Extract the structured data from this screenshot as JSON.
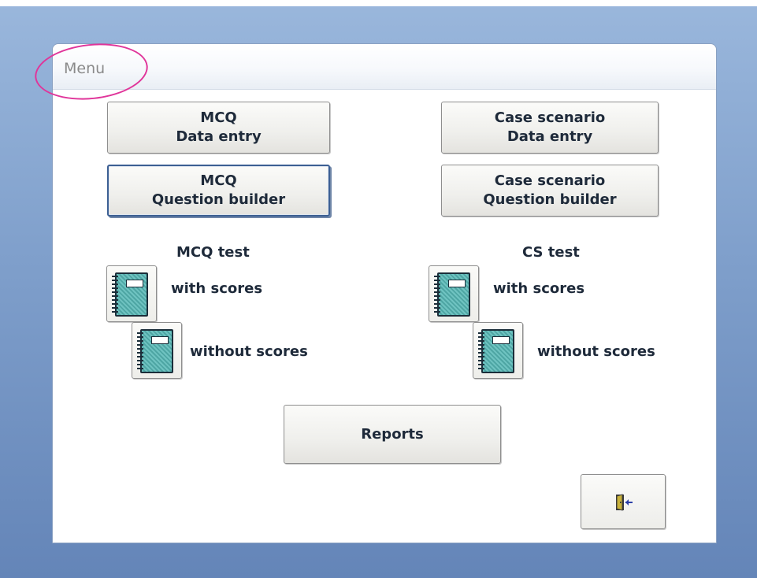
{
  "window": {
    "title": "Menu"
  },
  "mcq": {
    "data_entry": {
      "line1": "MCQ",
      "line2": "Data entry"
    },
    "question_builder": {
      "line1": "MCQ",
      "line2": "Question builder"
    },
    "test_heading": "MCQ test",
    "with_scores": "with scores",
    "without_scores": "without scores"
  },
  "case": {
    "data_entry": {
      "line1": "Case scenario",
      "line2": "Data entry"
    },
    "question_builder": {
      "line1": "Case scenario",
      "line2": "Question builder"
    },
    "test_heading": "CS test",
    "with_scores": "with scores",
    "without_scores": "without scores"
  },
  "reports_label": "Reports",
  "icons": {
    "notebook": "notebook-icon",
    "exit": "exit-door-icon"
  },
  "colors": {
    "highlight_circle": "#e0359a",
    "background": "#7f9fcb",
    "notebook_fill": "#6fc3c1"
  }
}
